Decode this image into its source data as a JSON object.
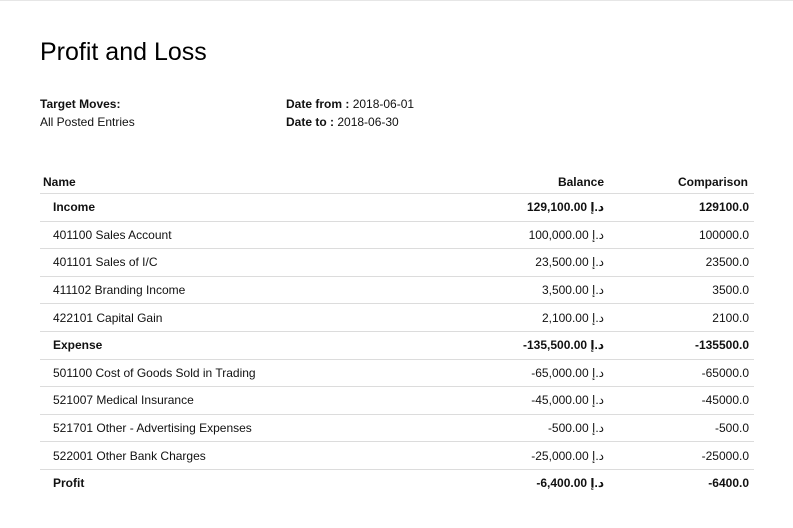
{
  "report": {
    "title": "Profit and Loss",
    "target_moves_label": "Target Moves:",
    "target_moves_value": "All Posted Entries",
    "date_from_label": "Date from :",
    "date_from_value": "2018-06-01",
    "date_to_label": "Date to :",
    "date_to_value": "2018-06-30"
  },
  "table": {
    "headers": {
      "name": "Name",
      "balance": "Balance",
      "comparison": "Comparison"
    },
    "rows": [
      {
        "name": "Income",
        "balance": "129,100.00 د.إ",
        "comparison": "129100.0",
        "bold": true
      },
      {
        "name": "401100 Sales Account",
        "balance": "100,000.00 د.إ",
        "comparison": "100000.0",
        "bold": false
      },
      {
        "name": "401101 Sales of I/C",
        "balance": "23,500.00 د.إ",
        "comparison": "23500.0",
        "bold": false
      },
      {
        "name": "411102 Branding Income",
        "balance": "3,500.00 د.إ",
        "comparison": "3500.0",
        "bold": false
      },
      {
        "name": "422101 Capital Gain",
        "balance": "2,100.00 د.إ",
        "comparison": "2100.0",
        "bold": false
      },
      {
        "name": "Expense",
        "balance": "-135,500.00 د.إ",
        "comparison": "-135500.0",
        "bold": true
      },
      {
        "name": "501100 Cost of Goods Sold in Trading",
        "balance": "-65,000.00 د.إ",
        "comparison": "-65000.0",
        "bold": false
      },
      {
        "name": "521007 Medical Insurance",
        "balance": "-45,000.00 د.إ",
        "comparison": "-45000.0",
        "bold": false
      },
      {
        "name": "521701 Other - Advertising Expenses",
        "balance": "-500.00 د.إ",
        "comparison": "-500.0",
        "bold": false
      },
      {
        "name": "522001 Other Bank Charges",
        "balance": "-25,000.00 د.إ",
        "comparison": "-25000.0",
        "bold": false
      },
      {
        "name": "Profit",
        "balance": "-6,400.00 د.إ",
        "comparison": "-6400.0",
        "bold": true
      }
    ]
  }
}
